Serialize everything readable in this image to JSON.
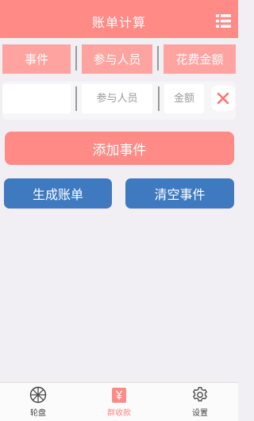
{
  "header": {
    "title": "账单计算",
    "menu_icon": "list-menu-icon"
  },
  "columns": {
    "event": "事件",
    "participants": "参与人员",
    "amount": "花费金额"
  },
  "input_row": {
    "event_value": "",
    "participants_placeholder": "参与人员",
    "amount_placeholder": "金额",
    "delete_icon": "close-x-icon"
  },
  "actions": {
    "add_event": "添加事件",
    "generate_bill": "生成账单",
    "clear_events": "清空事件"
  },
  "tabbar": {
    "items": [
      {
        "label": "轮盘",
        "icon": "wheel-icon",
        "active": false
      },
      {
        "label": "群收款",
        "icon": "yuan-receipt-icon",
        "active": true
      },
      {
        "label": "设置",
        "icon": "gear-icon",
        "active": false
      }
    ]
  },
  "colors": {
    "primary": "#ff8a86",
    "column_header": "#ffa3a0",
    "secondary_button": "#3f79c0",
    "background": "#f1eff3",
    "tab_active": "#ff8a86",
    "tab_inactive": "#444444"
  }
}
